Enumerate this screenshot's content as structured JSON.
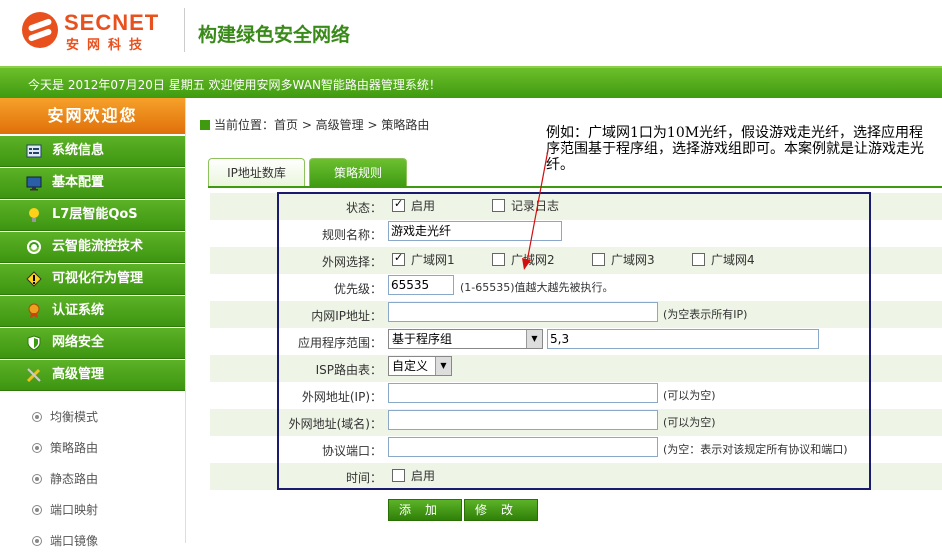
{
  "brand": {
    "logo_en": "SECNET",
    "logo_cn": "安网科技",
    "slogan": "构建绿色安全网络",
    "accent_color": "#3f9a10",
    "logo_color": "#e8501e"
  },
  "topbar": {
    "welcome": "今天是 2012年07月20日 星期五 欢迎使用安网多WAN智能路由器管理系统！"
  },
  "sidebar": {
    "header": "安网欢迎您",
    "items": [
      {
        "label": "系统信息",
        "icon": "chart-icon"
      },
      {
        "label": "基本配置",
        "icon": "monitor-icon"
      },
      {
        "label": "L7层智能QoS",
        "icon": "bulb-icon"
      },
      {
        "label": "云智能流控技术",
        "icon": "recycle-icon"
      },
      {
        "label": "可视化行为管理",
        "icon": "warning-icon"
      },
      {
        "label": "认证系统",
        "icon": "medal-icon"
      },
      {
        "label": "网络安全",
        "icon": "shield-icon"
      },
      {
        "label": "高级管理",
        "icon": "tools-icon"
      }
    ],
    "sub_items": [
      "均衡模式",
      "策略路由",
      "静态路由",
      "端口映射",
      "端口镜像"
    ]
  },
  "breadcrumb": "当前位置：首页 > 高级管理 > 策略路由",
  "tabs": [
    {
      "label": "IP地址数库",
      "active": false
    },
    {
      "label": "策略规则",
      "active": true
    }
  ],
  "form": {
    "status": {
      "label": "状态：",
      "enable": "启用",
      "enable_checked": true,
      "log": "记录日志",
      "log_checked": false
    },
    "rule_name": {
      "label": "规则名称：",
      "value": "游戏走光纤"
    },
    "wan": {
      "label": "外网选择：",
      "options": [
        {
          "name": "广域网1",
          "checked": true
        },
        {
          "name": "广域网2",
          "checked": false
        },
        {
          "name": "广域网3",
          "checked": false
        },
        {
          "name": "广域网4",
          "checked": false
        }
      ]
    },
    "priority": {
      "label": "优先级：",
      "value": "65535",
      "hint": "(1-65535)值越大越先被执行。"
    },
    "lan_ip": {
      "label": "内网IP地址：",
      "value": "",
      "hint": "(为空表示所有IP)"
    },
    "app_scope": {
      "label": "应用程序范围：",
      "selected": "基于程序组",
      "value": "5,3"
    },
    "isp_table": {
      "label": "ISP路由表：",
      "selected": "自定义"
    },
    "wan_ip": {
      "label": "外网地址(IP)：",
      "value": "",
      "hint": "(可以为空)"
    },
    "wan_domain": {
      "label": "外网地址(域名)：",
      "value": "",
      "hint": "(可以为空)"
    },
    "protocol_port": {
      "label": "协议端口：",
      "value": "",
      "hint": "(为空：表示对该规定所有协议和端口)"
    },
    "time": {
      "label": "时间：",
      "enable": "启用",
      "enable_checked": false
    }
  },
  "buttons": {
    "add": "添加",
    "modify": "修改"
  },
  "annotation": "例如：广域网1口为10M光纤，假设游戏走光纤，选择应用程序范围基于程序组，选择游戏组即可。本案例就是让游戏走光纤。"
}
